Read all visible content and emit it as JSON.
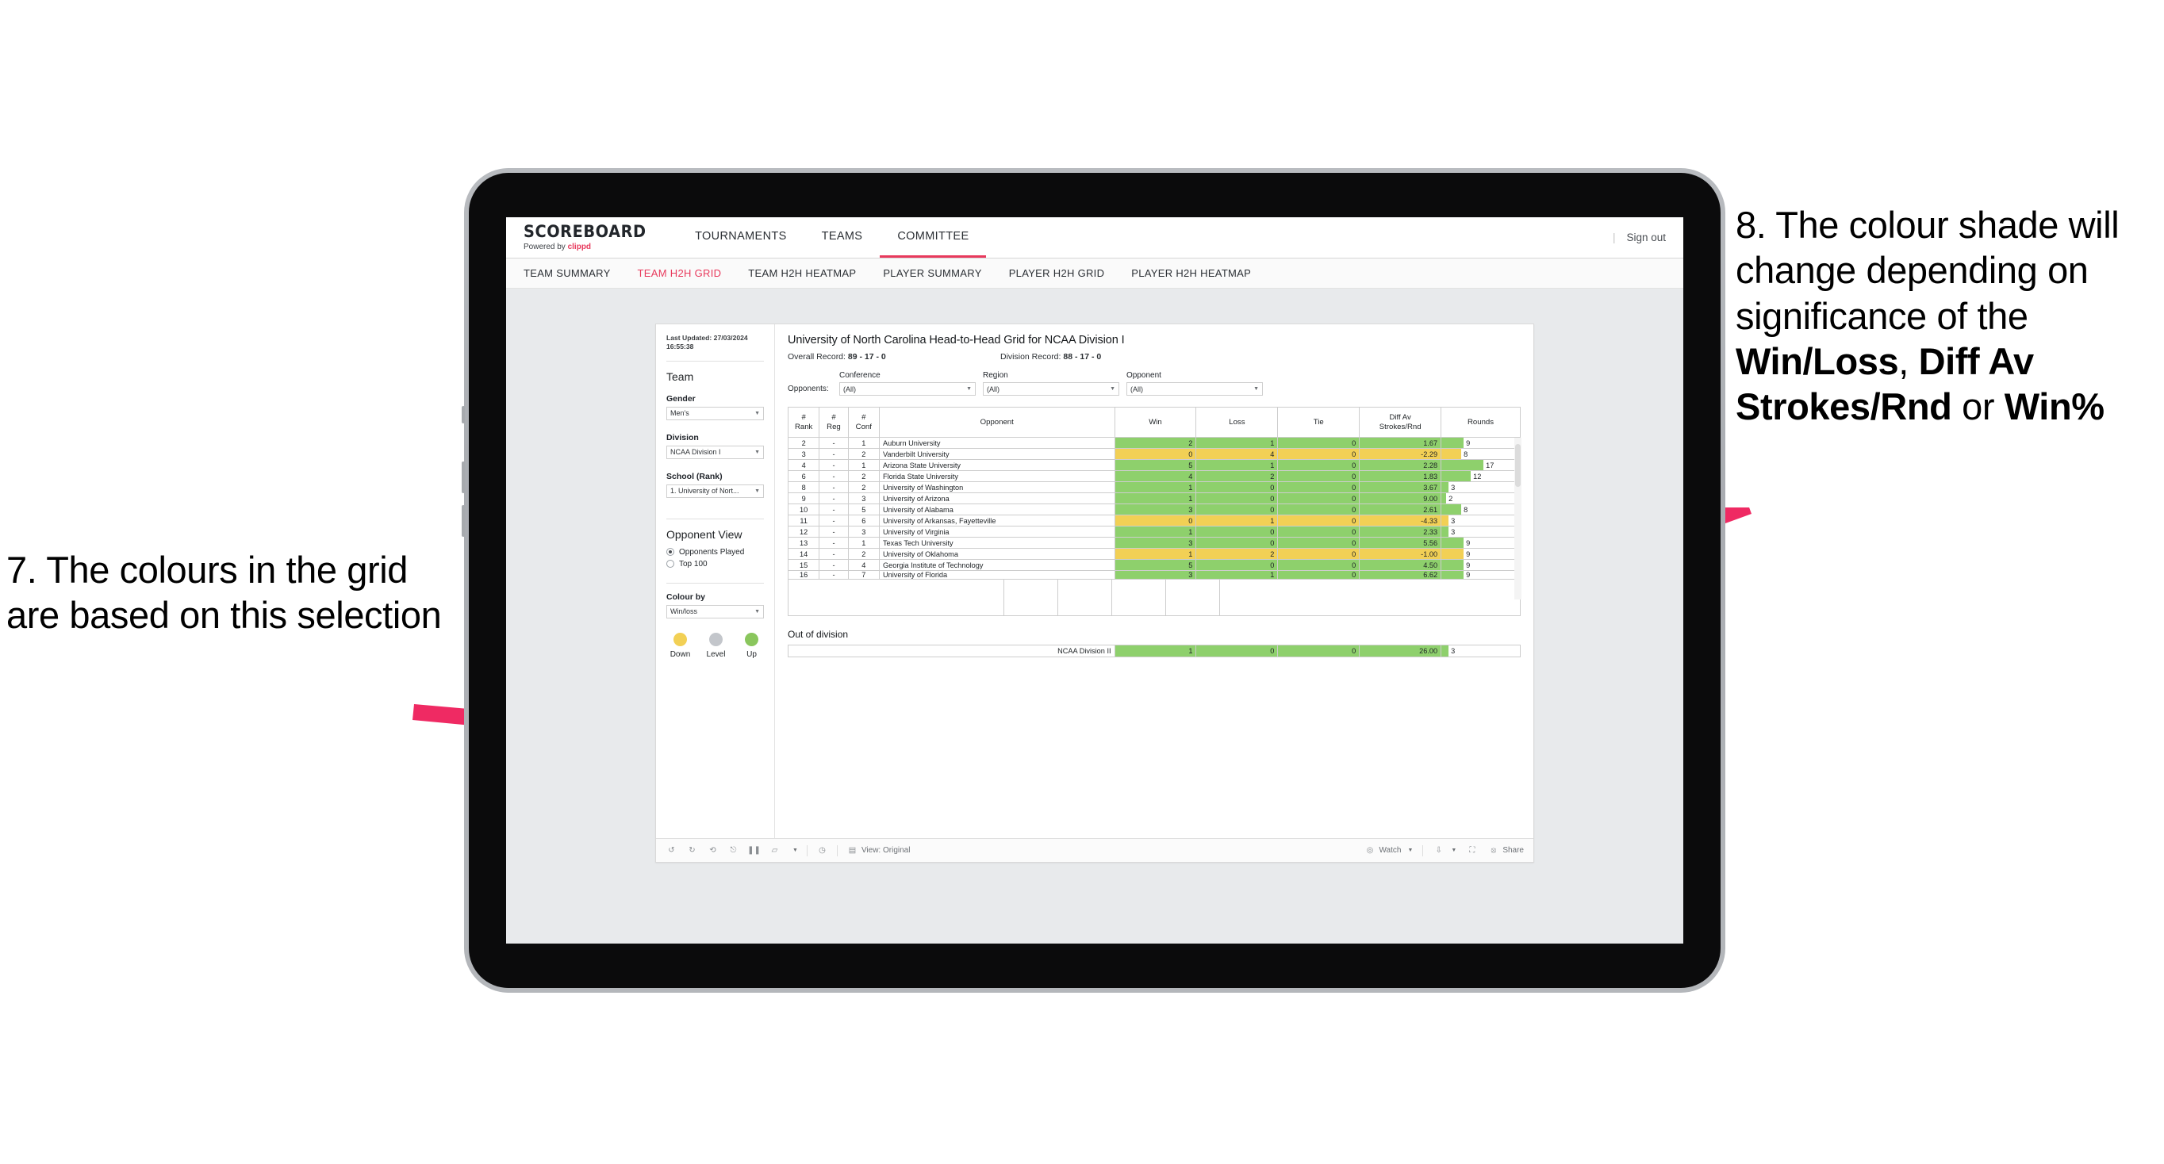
{
  "annotations": {
    "left": {
      "id": "7.",
      "text": "7. The colours in the grid are based on this selection"
    },
    "right": {
      "line1": "8. The colour shade will change depending on significance of the ",
      "bold1": "Win/Loss",
      "mid1": ", ",
      "bold2": "Diff Av Strokes/Rnd",
      "mid2": " or ",
      "bold3": "Win%"
    },
    "arrow_color": "#ef2a63"
  },
  "app": {
    "brand": {
      "name": "SCOREBOARD",
      "powered_prefix": "Powered by ",
      "powered_by": "clippd"
    },
    "main_nav": [
      {
        "label": "TOURNAMENTS",
        "active": false
      },
      {
        "label": "TEAMS",
        "active": false
      },
      {
        "label": "COMMITTEE",
        "active": true
      }
    ],
    "sign_out": "Sign out",
    "sub_nav": [
      {
        "label": "TEAM SUMMARY",
        "active": false
      },
      {
        "label": "TEAM H2H GRID",
        "active": true
      },
      {
        "label": "TEAM H2H HEATMAP",
        "active": false
      },
      {
        "label": "PLAYER SUMMARY",
        "active": false
      },
      {
        "label": "PLAYER H2H GRID",
        "active": false
      },
      {
        "label": "PLAYER H2H HEATMAP",
        "active": false
      }
    ],
    "accent": "#e8395c"
  },
  "panel": {
    "last_updated": "Last Updated: 27/03/2024 16:55:38",
    "team_heading": "Team",
    "gender": {
      "label": "Gender",
      "value": "Men's"
    },
    "division": {
      "label": "Division",
      "value": "NCAA Division I"
    },
    "school": {
      "label": "School (Rank)",
      "value": "1. University of Nort..."
    },
    "opponent_view": {
      "heading": "Opponent View",
      "options": [
        {
          "label": "Opponents Played",
          "selected": true
        },
        {
          "label": "Top 100",
          "selected": false
        }
      ]
    },
    "colour_by": {
      "label": "Colour by",
      "value": "Win/loss"
    },
    "legend": [
      {
        "label": "Down",
        "color": "#f2d055"
      },
      {
        "label": "Level",
        "color": "#c3c6cb"
      },
      {
        "label": "Up",
        "color": "#8ac65d"
      }
    ]
  },
  "view": {
    "title": "University of North Carolina Head-to-Head Grid for NCAA Division I",
    "overall_record_label": "Overall Record: ",
    "overall_record": "89 - 17 - 0",
    "division_record_label": "Division Record: ",
    "division_record": "88 - 17 - 0",
    "opponents_label": "Opponents:",
    "filters": [
      {
        "label": "Conference",
        "value": "(All)"
      },
      {
        "label": "Region",
        "value": "(All)"
      },
      {
        "label": "Opponent",
        "value": "(All)"
      }
    ]
  },
  "chart_data": {
    "type": "table",
    "title": "University of North Carolina Head-to-Head Grid for NCAA Division I",
    "columns": [
      "# Rank",
      "# Reg",
      "# Conf",
      "Opponent",
      "Win",
      "Loss",
      "Tie",
      "Diff Av Strokes/Rnd",
      "Rounds"
    ],
    "rounds_max": 17,
    "colour_rule": "green = up (net win), yellow = down (net loss)",
    "rows": [
      {
        "rank": "2",
        "reg": "-",
        "conf": "1",
        "opponent": "Auburn University",
        "win": "2",
        "loss": "1",
        "tie": "0",
        "diff": "1.67",
        "rounds": 9,
        "state": "up"
      },
      {
        "rank": "3",
        "reg": "-",
        "conf": "2",
        "opponent": "Vanderbilt University",
        "win": "0",
        "loss": "4",
        "tie": "0",
        "diff": "-2.29",
        "rounds": 8,
        "state": "down"
      },
      {
        "rank": "4",
        "reg": "-",
        "conf": "1",
        "opponent": "Arizona State University",
        "win": "5",
        "loss": "1",
        "tie": "0",
        "diff": "2.28",
        "rounds": 17,
        "state": "up"
      },
      {
        "rank": "6",
        "reg": "-",
        "conf": "2",
        "opponent": "Florida State University",
        "win": "4",
        "loss": "2",
        "tie": "0",
        "diff": "1.83",
        "rounds": 12,
        "state": "up"
      },
      {
        "rank": "8",
        "reg": "-",
        "conf": "2",
        "opponent": "University of Washington",
        "win": "1",
        "loss": "0",
        "tie": "0",
        "diff": "3.67",
        "rounds": 3,
        "state": "up"
      },
      {
        "rank": "9",
        "reg": "-",
        "conf": "3",
        "opponent": "University of Arizona",
        "win": "1",
        "loss": "0",
        "tie": "0",
        "diff": "9.00",
        "rounds": 2,
        "state": "up"
      },
      {
        "rank": "10",
        "reg": "-",
        "conf": "5",
        "opponent": "University of Alabama",
        "win": "3",
        "loss": "0",
        "tie": "0",
        "diff": "2.61",
        "rounds": 8,
        "state": "up"
      },
      {
        "rank": "11",
        "reg": "-",
        "conf": "6",
        "opponent": "University of Arkansas, Fayetteville",
        "win": "0",
        "loss": "1",
        "tie": "0",
        "diff": "-4.33",
        "rounds": 3,
        "state": "down"
      },
      {
        "rank": "12",
        "reg": "-",
        "conf": "3",
        "opponent": "University of Virginia",
        "win": "1",
        "loss": "0",
        "tie": "0",
        "diff": "2.33",
        "rounds": 3,
        "state": "up"
      },
      {
        "rank": "13",
        "reg": "-",
        "conf": "1",
        "opponent": "Texas Tech University",
        "win": "3",
        "loss": "0",
        "tie": "0",
        "diff": "5.56",
        "rounds": 9,
        "state": "up"
      },
      {
        "rank": "14",
        "reg": "-",
        "conf": "2",
        "opponent": "University of Oklahoma",
        "win": "1",
        "loss": "2",
        "tie": "0",
        "diff": "-1.00",
        "rounds": 9,
        "state": "down"
      },
      {
        "rank": "15",
        "reg": "-",
        "conf": "4",
        "opponent": "Georgia Institute of Technology",
        "win": "5",
        "loss": "0",
        "tie": "0",
        "diff": "4.50",
        "rounds": 9,
        "state": "up"
      },
      {
        "rank": "16",
        "reg": "-",
        "conf": "7",
        "opponent": "University of Florida",
        "win": "3",
        "loss": "1",
        "tie": "0",
        "diff": "6.62",
        "rounds": 9,
        "state": "up"
      }
    ],
    "out_of_division": {
      "title": "Out of division",
      "rows": [
        {
          "opponent": "NCAA Division II",
          "win": "1",
          "loss": "0",
          "tie": "0",
          "diff": "26.00",
          "rounds": 3,
          "state": "up"
        }
      ]
    }
  },
  "toolbar": {
    "view_label": "View: Original",
    "watch_label": "Watch",
    "share_label": "Share"
  }
}
